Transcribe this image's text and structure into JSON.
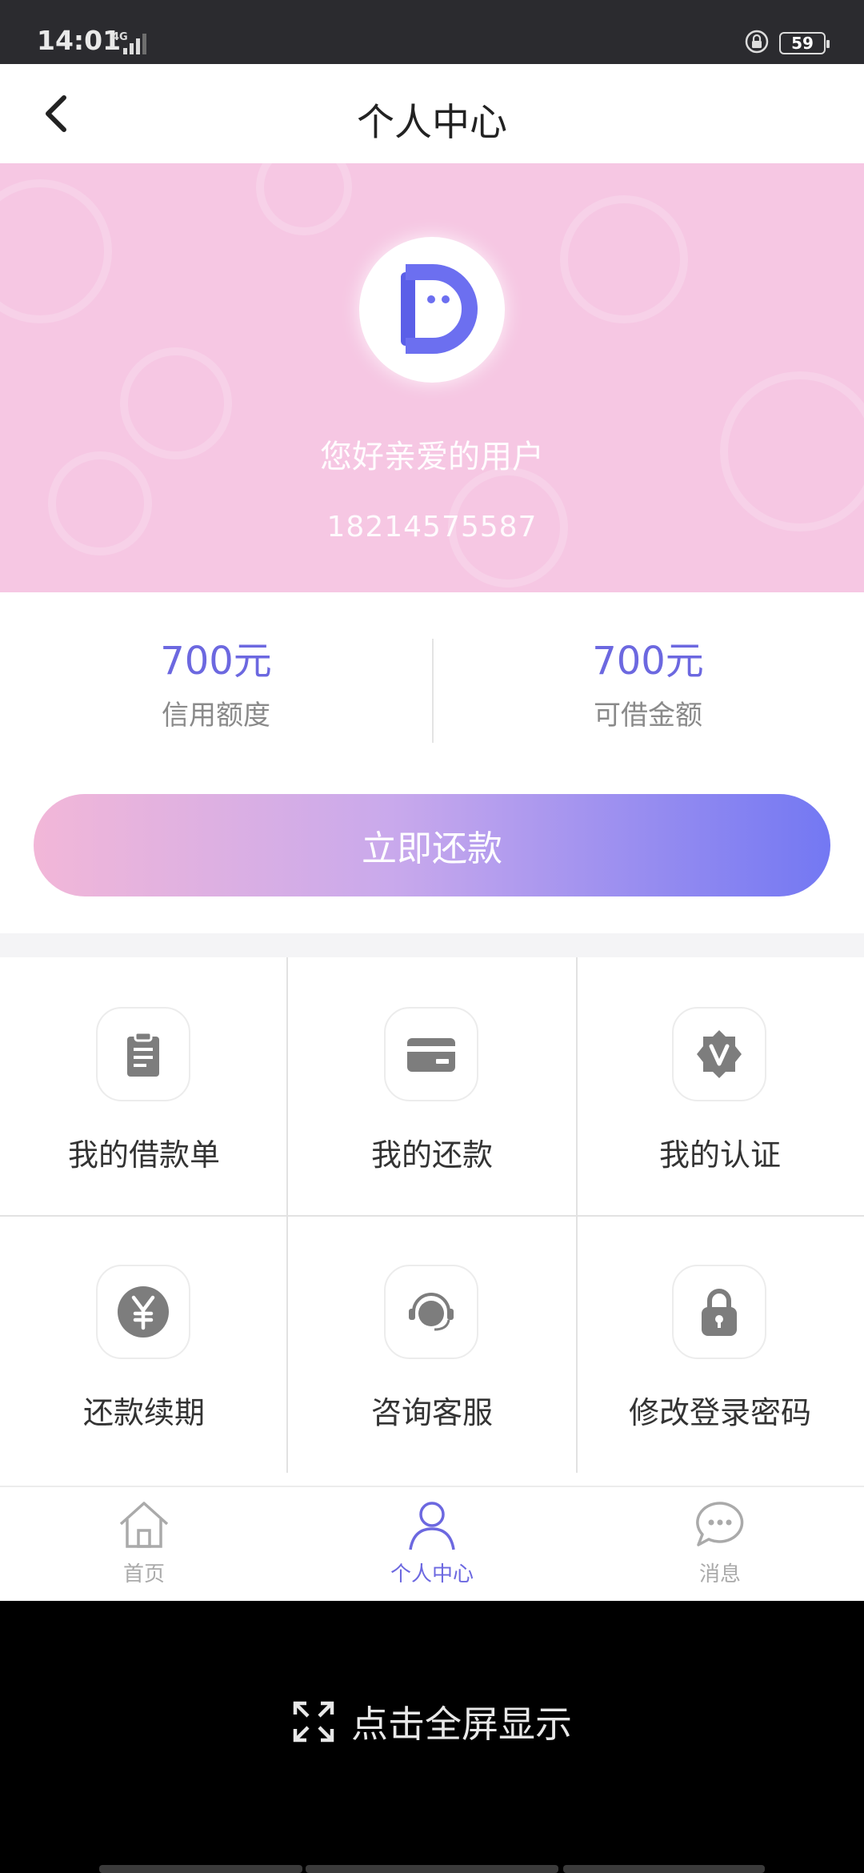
{
  "status_bar": {
    "time": "14:01",
    "network": "4G",
    "battery": "59"
  },
  "header": {
    "title": "个人中心"
  },
  "profile": {
    "greeting": "您好亲爱的用户",
    "phone": "18214575587"
  },
  "amounts": [
    {
      "value": "700元",
      "label": "信用额度"
    },
    {
      "value": "700元",
      "label": "可借金额"
    }
  ],
  "repay_button": "立即还款",
  "menu": [
    {
      "label": "我的借款单",
      "icon": "clipboard-icon"
    },
    {
      "label": "我的还款",
      "icon": "card-icon"
    },
    {
      "label": "我的认证",
      "icon": "verified-badge-icon"
    },
    {
      "label": "还款续期",
      "icon": "yuan-icon"
    },
    {
      "label": "咨询客服",
      "icon": "headset-icon"
    },
    {
      "label": "修改登录密码",
      "icon": "lock-icon"
    }
  ],
  "bottom_nav": [
    {
      "label": "首页",
      "icon": "home-icon",
      "active": false
    },
    {
      "label": "个人中心",
      "icon": "person-icon",
      "active": true
    },
    {
      "label": "消息",
      "icon": "message-icon",
      "active": false
    }
  ],
  "fullscreen_label": "点击全屏显示",
  "colors": {
    "accent": "#6c68e0",
    "banner": "#f6c7e3",
    "gradient_start": "#f2b7d8",
    "gradient_end": "#7378f3"
  }
}
